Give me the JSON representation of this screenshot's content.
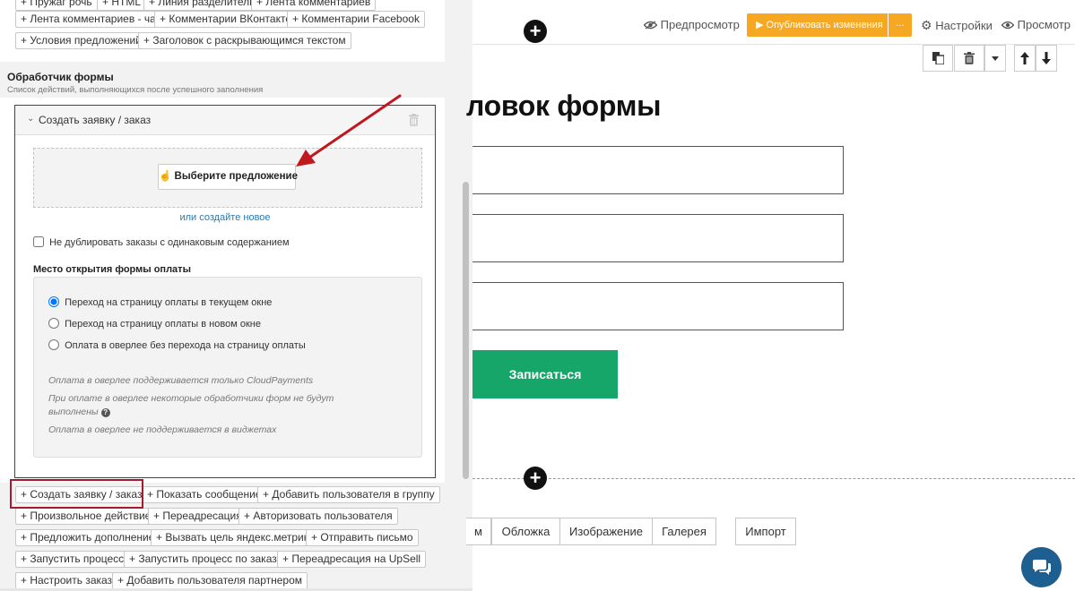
{
  "left": {
    "top_chips_row0": [
      "+ Пружаг рочь",
      "+ HTML",
      "+ Линия разделитель",
      "+ Лента комментариев"
    ],
    "top_chips_row1": [
      "+ Лента комментариев - чат",
      "+ Комментарии ВКонтакте",
      "+ Комментарии Facebook"
    ],
    "top_chips_row2": [
      "+ Условия предложений",
      "+ Заголовок с раскрывающимся текстом"
    ],
    "section_title": "Обработчик формы",
    "section_subtitle": "Список действий, выполняющихся после успешного заполнения",
    "handler": {
      "title": "Создать заявку / заказ",
      "choose_offer_label": "Выберите предложение",
      "create_new_link": "или создайте новое",
      "no_duplicate_label": "Не дублировать заказы с одинаковым содержанием",
      "no_duplicate_checked": false,
      "payment_title": "Место открытия формы оплаты",
      "payment_options": [
        {
          "label": "Переход на страницу оплаты в текущем окне",
          "selected": true
        },
        {
          "label": "Переход на страницу оплаты в новом окне",
          "selected": false
        },
        {
          "label": "Оплата в оверлее без перехода на страницу оплаты",
          "selected": false
        }
      ],
      "notes": {
        "cloudpayments": "Оплата в оверлее поддерживается только CloudPayments",
        "handlers_line1": "При оплате в оверлее некоторые обработчики форм не будут",
        "handlers_line2": "выполнены",
        "widgets": "Оплата в оверлее не поддерживается в виджетах"
      }
    },
    "action_chips": [
      [
        "+ Создать заявку / заказ",
        "+ Показать сообщение",
        "+ Добавить пользователя в группу"
      ],
      [
        "+ Произвольное действие",
        "+ Переадресация",
        "+ Авторизовать пользователя"
      ],
      [
        "+ Предложить дополнение",
        "+ Вызвать цель яндекс.метрики",
        "+ Отправить письмо"
      ],
      [
        "+ Запустить процесс",
        "+ Запустить процесс по заказу",
        "+ Переадресация на UpSell"
      ],
      [
        "+ Настроить заказ",
        "+ Добавить пользователя партнером"
      ]
    ]
  },
  "topbar": {
    "preview_label": "Предпросмотр",
    "publish_label": "▶ Опубликовать изменения",
    "publish_more": "...",
    "settings_label": "Настройки",
    "view_label": "Просмотр"
  },
  "preview": {
    "heading": "ловок формы",
    "submit_label": "Записаться",
    "block_tabs": [
      "м",
      "Обложка",
      "Изображение",
      "Галерея"
    ],
    "import_label": "Импорт"
  },
  "colors": {
    "publish": "#f7a823",
    "submit": "#16a66a",
    "highlight": "#a8182f",
    "arrow": "#c0181f",
    "chat": "#1d5f90",
    "link": "#2a7ab0"
  },
  "icons": {
    "trash": "trash-icon",
    "copy": "copy-icon",
    "eye": "eye-icon",
    "gear": "gear-icon",
    "hand": "hand-pointer-icon",
    "chat": "chat-icon"
  }
}
